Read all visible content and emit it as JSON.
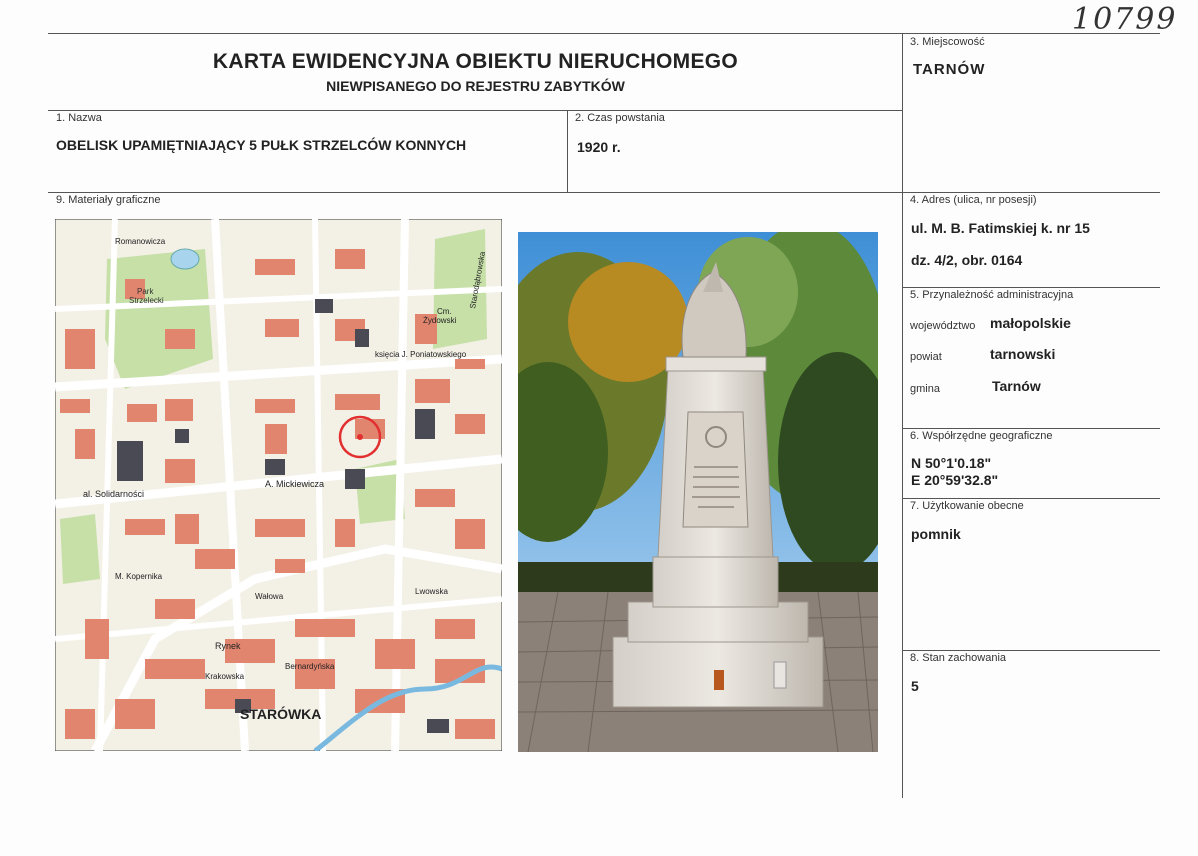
{
  "handwritten_number": "10799",
  "header": {
    "title": "KARTA EWIDENCYJNA OBIEKTU NIERUCHOMEGO",
    "subtitle": "NIEWPISANEGO DO REJESTRU ZABYTKÓW"
  },
  "fields": {
    "name": {
      "label": "1. Nazwa",
      "value": "OBELISK UPAMIĘTNIAJĄCY 5 PUŁK STRZELCÓW KONNYCH"
    },
    "time": {
      "label": "2. Czas powstania",
      "value": "1920 r."
    },
    "place": {
      "label": "3. Miejscowość",
      "value": "TARNÓW"
    },
    "address": {
      "label": "4. Adres (ulica, nr posesji)",
      "line1": "ul. M. B. Fatimskiej k. nr 15",
      "line2": "dz. 4/2, obr. 0164"
    },
    "admin": {
      "label": "5. Przynależność administracyjna",
      "rows": [
        {
          "key": "województwo",
          "value": "małopolskie"
        },
        {
          "key": "powiat",
          "value": "tarnowski"
        },
        {
          "key": "gmina",
          "value": "Tarnów"
        }
      ]
    },
    "coords": {
      "label": "6. Współrzędne geograficzne",
      "n": "N 50°1'0.18\"",
      "e": "E 20°59'32.8\""
    },
    "usage": {
      "label": "7. Użytkowanie obecne",
      "value": "pomnik"
    },
    "condition": {
      "label": "8. Stan zachowania",
      "value": "5"
    },
    "graphics": {
      "label": "9. Materiały graficzne"
    }
  },
  "map": {
    "labels": {
      "park": "Park",
      "park2": "Strzelecki",
      "solidarnosci": "al. Solidarności",
      "mickiewicza": "A. Mickiewicza",
      "starowka": "STARÓWKA",
      "rynek": "Rynek",
      "ponia": "księcia J. Poniatowskiego",
      "cm": "Cm.",
      "zyd": "Żydowski",
      "walowa": "Wałowa",
      "lwowska": "Lwowska",
      "krakowska": "Krakowska",
      "romanowicza": "Romanowicza",
      "starodabrowska": "Starodąbrowska",
      "kopernika": "M. Kopernika",
      "bernardynska": "Bernardyńska"
    }
  },
  "colors": {
    "map_bg": "#f3f0e6",
    "map_building": "#e2856f",
    "map_green": "#c6e0a8",
    "map_dark": "#4a4a55",
    "marker": "#e23030"
  }
}
